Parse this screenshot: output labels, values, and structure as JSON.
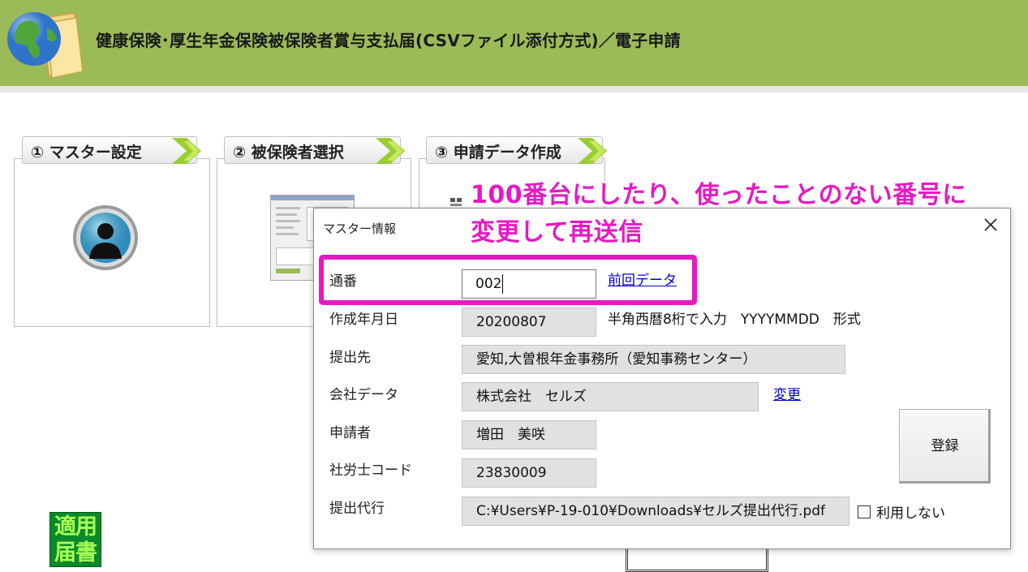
{
  "header": {
    "title": "健康保険･厚生年金保険被保険者賞与支払届(CSVファイル添付方式)／電子申請",
    "bg_color": "#9bbb59"
  },
  "steps": [
    {
      "label": "① マスター設定",
      "icon": "person-avatar-icon"
    },
    {
      "label": "② 被保険者選択",
      "icon": "screen-thumbnail"
    },
    {
      "label": "③ 申請データ作成",
      "icon": "document-thumbnail"
    }
  ],
  "logo": {
    "line1": "適用",
    "line2": "届書"
  },
  "dialog": {
    "title": "マスター情報",
    "close_icon": "close-icon",
    "fields": {
      "serial": {
        "label": "通番",
        "value": "002",
        "link": "前回データ"
      },
      "created_date": {
        "label": "作成年月日",
        "value": "20200807",
        "hint": "半角西暦8桁で入力　YYYYMMDD　形式"
      },
      "submit_to": {
        "label": "提出先",
        "value": "愛知,大曽根年金事務所（愛知事務センター）"
      },
      "company": {
        "label": "会社データ",
        "value": "株式会社　セルズ",
        "link": "変更"
      },
      "applicant": {
        "label": "申請者",
        "value": "増田　美咲"
      },
      "sr_code": {
        "label": "社労士コード",
        "value": "23830009"
      },
      "agent": {
        "label": "提出代行",
        "value": "C:¥Users¥P-19-010¥Downloads¥セルズ提出代行.pdf",
        "checkbox_label": "利用しない",
        "checked": false
      }
    },
    "register_label": "登録"
  },
  "annotation": {
    "line1": "100番台にしたり、使ったことのない番号に",
    "line2": "変更して再送信",
    "color": "#e619c4"
  }
}
